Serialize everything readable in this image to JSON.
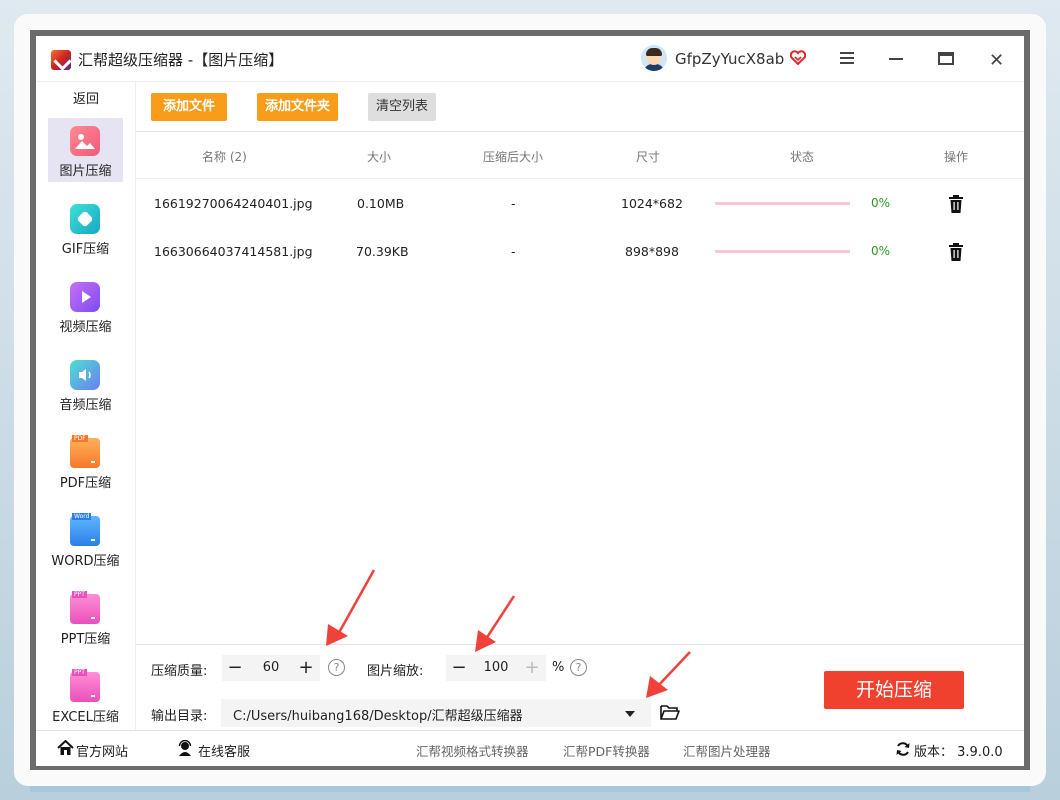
{
  "window": {
    "app_name": "汇帮超级压缩器",
    "module_title": " -【图片压缩】",
    "username": "GfpZyYucX8ab",
    "menu_icon": "hamburger-menu-icon",
    "maximize_icon": "maximize-icon",
    "close_icon": "✕"
  },
  "sidebar": {
    "back": "返回",
    "items": [
      {
        "label": "图片压缩",
        "icon": "image-icon",
        "color": "#f26a7e",
        "active": true
      },
      {
        "label": "GIF压缩",
        "icon": "gif-icon",
        "color": "#27c6c9",
        "active": false
      },
      {
        "label": "视频压缩",
        "icon": "video-icon",
        "color": "#9a5ef0",
        "active": false
      },
      {
        "label": "音频压缩",
        "icon": "audio-icon",
        "color": "#4fa6e8",
        "active": false
      },
      {
        "label": "PDF压缩",
        "icon": "pdf-icon",
        "color": "#f78b34",
        "active": false
      },
      {
        "label": "WORD压缩",
        "icon": "word-icon",
        "color": "#3b8ee8",
        "active": false
      },
      {
        "label": "PPT压缩",
        "icon": "ppt-icon",
        "color": "#f267c1",
        "active": false
      },
      {
        "label": "EXCEL压缩",
        "icon": "excel-icon",
        "color": "#f267c1",
        "active": false
      }
    ],
    "icon_tags": {
      "pdf": "PDF",
      "word": "Word",
      "ppt": "PPT",
      "excel": "PPT"
    }
  },
  "toolbar": {
    "add_file": "添加文件",
    "add_folder": "添加文件夹",
    "clear_list": "清空列表"
  },
  "table": {
    "headers": [
      "名称 (2)",
      "大小",
      "压缩后大小",
      "尺寸",
      "状态",
      "操作"
    ],
    "rows": [
      {
        "name": "16619270064240401.jpg",
        "size": "0.10MB",
        "compressed": "-",
        "dimensions": "1024*682",
        "progress": 0,
        "status": "0%"
      },
      {
        "name": "16630664037414581.jpg",
        "size": "70.39KB",
        "compressed": "-",
        "dimensions": "898*898",
        "progress": 0,
        "status": "0%"
      }
    ]
  },
  "controls": {
    "quality_label": "压缩质量:",
    "quality_value": "60",
    "scale_label": "图片缩放:",
    "scale_value": "100",
    "scale_unit": "%",
    "minus": "−",
    "plus": "+",
    "help": "?",
    "output_label": "输出目录:",
    "output_path": "C:/Users/huibang168/Desktop/汇帮超级压缩器",
    "start": "开始压缩"
  },
  "footer": {
    "website": "官方网站",
    "support": "在线客服",
    "link1": "汇帮视频格式转换器",
    "link2": "汇帮PDF转换器",
    "link3": "汇帮图片处理器",
    "version": "版本： 3.9.0.0"
  },
  "colors": {
    "accent_orange": "#f89c1a",
    "start_red": "#f0412f",
    "progress_pink": "#f8c6d6",
    "status_green": "#2a9a2a",
    "annotation_arrow": "#f0413a"
  }
}
